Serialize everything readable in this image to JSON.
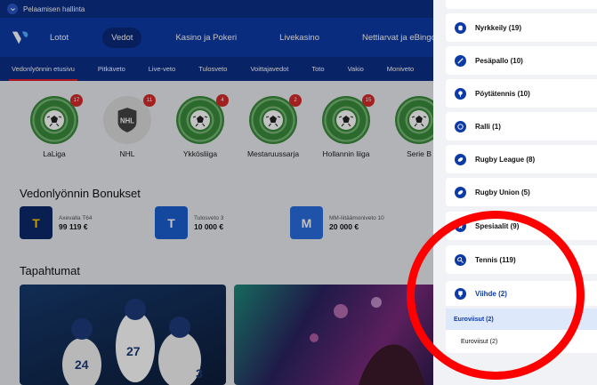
{
  "topbar": {
    "label": "Pelaamisen hallinta"
  },
  "mainnav": {
    "items": [
      "Lotot",
      "Vedot",
      "Kasino ja Pokeri",
      "Livekasino",
      "Nettiarvat ja eBingo"
    ]
  },
  "subnav": {
    "items": [
      "Vedonlyönnin etusivu",
      "Pitkäveto",
      "Live-veto",
      "Tulosveto",
      "Voittajavedot",
      "Toto",
      "Vakio",
      "Moniveto"
    ]
  },
  "leagues": [
    {
      "name": "LaLiga",
      "badge": "17"
    },
    {
      "name": "NHL",
      "badge": "11"
    },
    {
      "name": "Ykkösliiga",
      "badge": "4"
    },
    {
      "name": "Mestaruussarja",
      "badge": "2"
    },
    {
      "name": "Hollannin liiga",
      "badge": "15"
    },
    {
      "name": "Serie B",
      "badge": ""
    }
  ],
  "bonuses": {
    "title": "Vedonlyönnin Bonukset",
    "items": [
      {
        "tile": "T",
        "label": "Axevalla T64",
        "amount": "99 119 €"
      },
      {
        "tile": "T",
        "label": "Tulosveto 3",
        "amount": "10 000 €"
      },
      {
        "tile": "M",
        "label": "MM-liitäämoniveto 10",
        "amount": "20 000 €"
      }
    ]
  },
  "events": {
    "title": "Tapahtumat"
  },
  "panel": {
    "categories": [
      {
        "label": "Nyrkkeily (19)",
        "icon": "boxing-glove-icon"
      },
      {
        "label": "Pesäpallo (10)",
        "icon": "bat-icon"
      },
      {
        "label": "Pöytätennis (10)",
        "icon": "ping-pong-icon"
      },
      {
        "label": "Ralli (1)",
        "icon": "steering-wheel-icon"
      },
      {
        "label": "Rugby League (8)",
        "icon": "rugby-ball-icon"
      },
      {
        "label": "Rugby Union (5)",
        "icon": "rugby-ball-icon"
      },
      {
        "label": "Spesiaalit (9)",
        "icon": "star-icon"
      },
      {
        "label": "Tennis (119)",
        "icon": "tennis-icon"
      },
      {
        "label": "Viihde (2)",
        "icon": "trophy-icon"
      }
    ],
    "subgroup": "Euroviisut (2)",
    "leaf": "Euroviisut (2)"
  },
  "colors": {
    "brand_dark": "#0b2f87",
    "brand": "#0e3aa6",
    "accent_red": "#e21e2b",
    "ring": "#ff0000"
  }
}
